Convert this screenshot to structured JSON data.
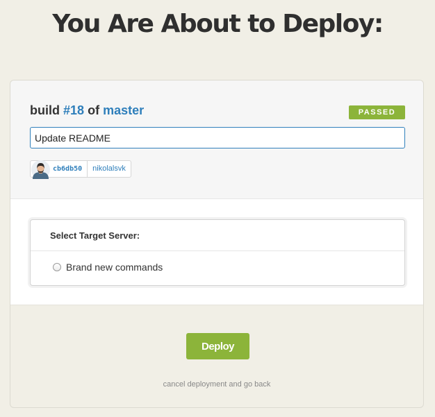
{
  "page": {
    "title": "You Are About to Deploy:"
  },
  "build": {
    "prefix": "build",
    "number": "#18",
    "joiner": "of",
    "branch": "master",
    "status": "PASSED",
    "message": "Update README",
    "commit_sha": "cb6db50",
    "author": "nikolalsvk"
  },
  "server_select": {
    "heading": "Select Target Server:",
    "options": [
      {
        "label": "Brand new commands",
        "selected": false
      }
    ]
  },
  "actions": {
    "deploy_label": "Deploy",
    "cancel_label": "cancel deployment and go back"
  },
  "colors": {
    "background": "#f1efe6",
    "accent_green": "#8cb43a",
    "link_blue": "#2f7fbb",
    "title_dark": "#2f2f2f"
  },
  "icons": {
    "avatar": "user-avatar-icon",
    "radio": "radio-unchecked-icon"
  }
}
